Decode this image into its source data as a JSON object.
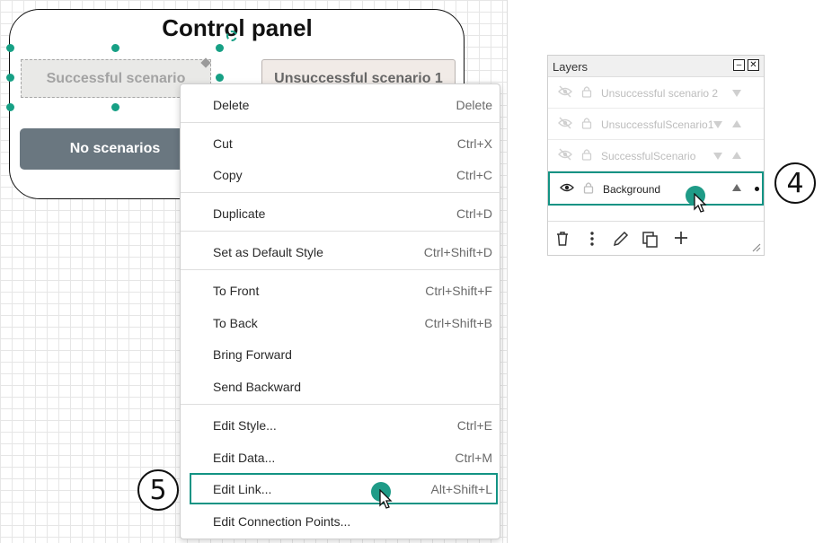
{
  "diagram": {
    "title": "Control panel",
    "buttons": {
      "successful": "Successful scenario",
      "unsuccessful": "Unsuccessful scenario 1",
      "none": "No scenarios"
    }
  },
  "context_menu": {
    "items": [
      {
        "label": "Delete",
        "shortcut": "Delete"
      },
      {
        "label": "Cut",
        "shortcut": "Ctrl+X"
      },
      {
        "label": "Copy",
        "shortcut": "Ctrl+C"
      },
      {
        "label": "Duplicate",
        "shortcut": "Ctrl+D"
      },
      {
        "label": "Set as Default Style",
        "shortcut": "Ctrl+Shift+D"
      },
      {
        "label": "To Front",
        "shortcut": "Ctrl+Shift+F"
      },
      {
        "label": "To Back",
        "shortcut": "Ctrl+Shift+B"
      },
      {
        "label": "Bring Forward",
        "shortcut": ""
      },
      {
        "label": "Send Backward",
        "shortcut": ""
      },
      {
        "label": "Edit Style...",
        "shortcut": "Ctrl+E"
      },
      {
        "label": "Edit Data...",
        "shortcut": "Ctrl+M"
      },
      {
        "label": "Edit Link...",
        "shortcut": "Alt+Shift+L"
      },
      {
        "label": "Edit Connection Points...",
        "shortcut": ""
      }
    ]
  },
  "layers": {
    "title": "Layers",
    "minimize": "–",
    "close": "✕",
    "rows": [
      {
        "name": "Unsuccessful scenario 2"
      },
      {
        "name": "UnsuccessfulScenario1"
      },
      {
        "name": "SuccessfulScenario"
      },
      {
        "name": "Background"
      }
    ]
  },
  "callouts": {
    "four": "4",
    "five": "5"
  },
  "colors": {
    "accent": "#17a085",
    "highlight_border": "#139384",
    "no_scenarios_bg": "#6a7780"
  }
}
